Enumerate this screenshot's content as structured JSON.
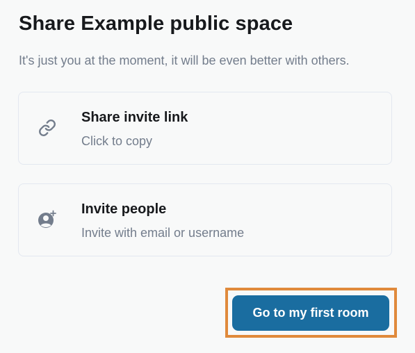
{
  "dialog": {
    "title": "Share Example public space",
    "subtitle": "It's just you at the moment, it will be even better with others."
  },
  "options": [
    {
      "title": "Share invite link",
      "description": "Click to copy",
      "icon": "link-icon"
    },
    {
      "title": "Invite people",
      "description": "Invite with email or username",
      "icon": "invite-user-icon"
    }
  ],
  "footer": {
    "primary_label": "Go to my first room"
  },
  "colors": {
    "background": "#f8f9f9",
    "title_text": "#17191c",
    "secondary_text": "#737d8c",
    "card_border": "#e3e8f0",
    "icon": "#737d8c",
    "primary_button": "#1a6da0",
    "highlight_outline": "#e08a3c"
  }
}
